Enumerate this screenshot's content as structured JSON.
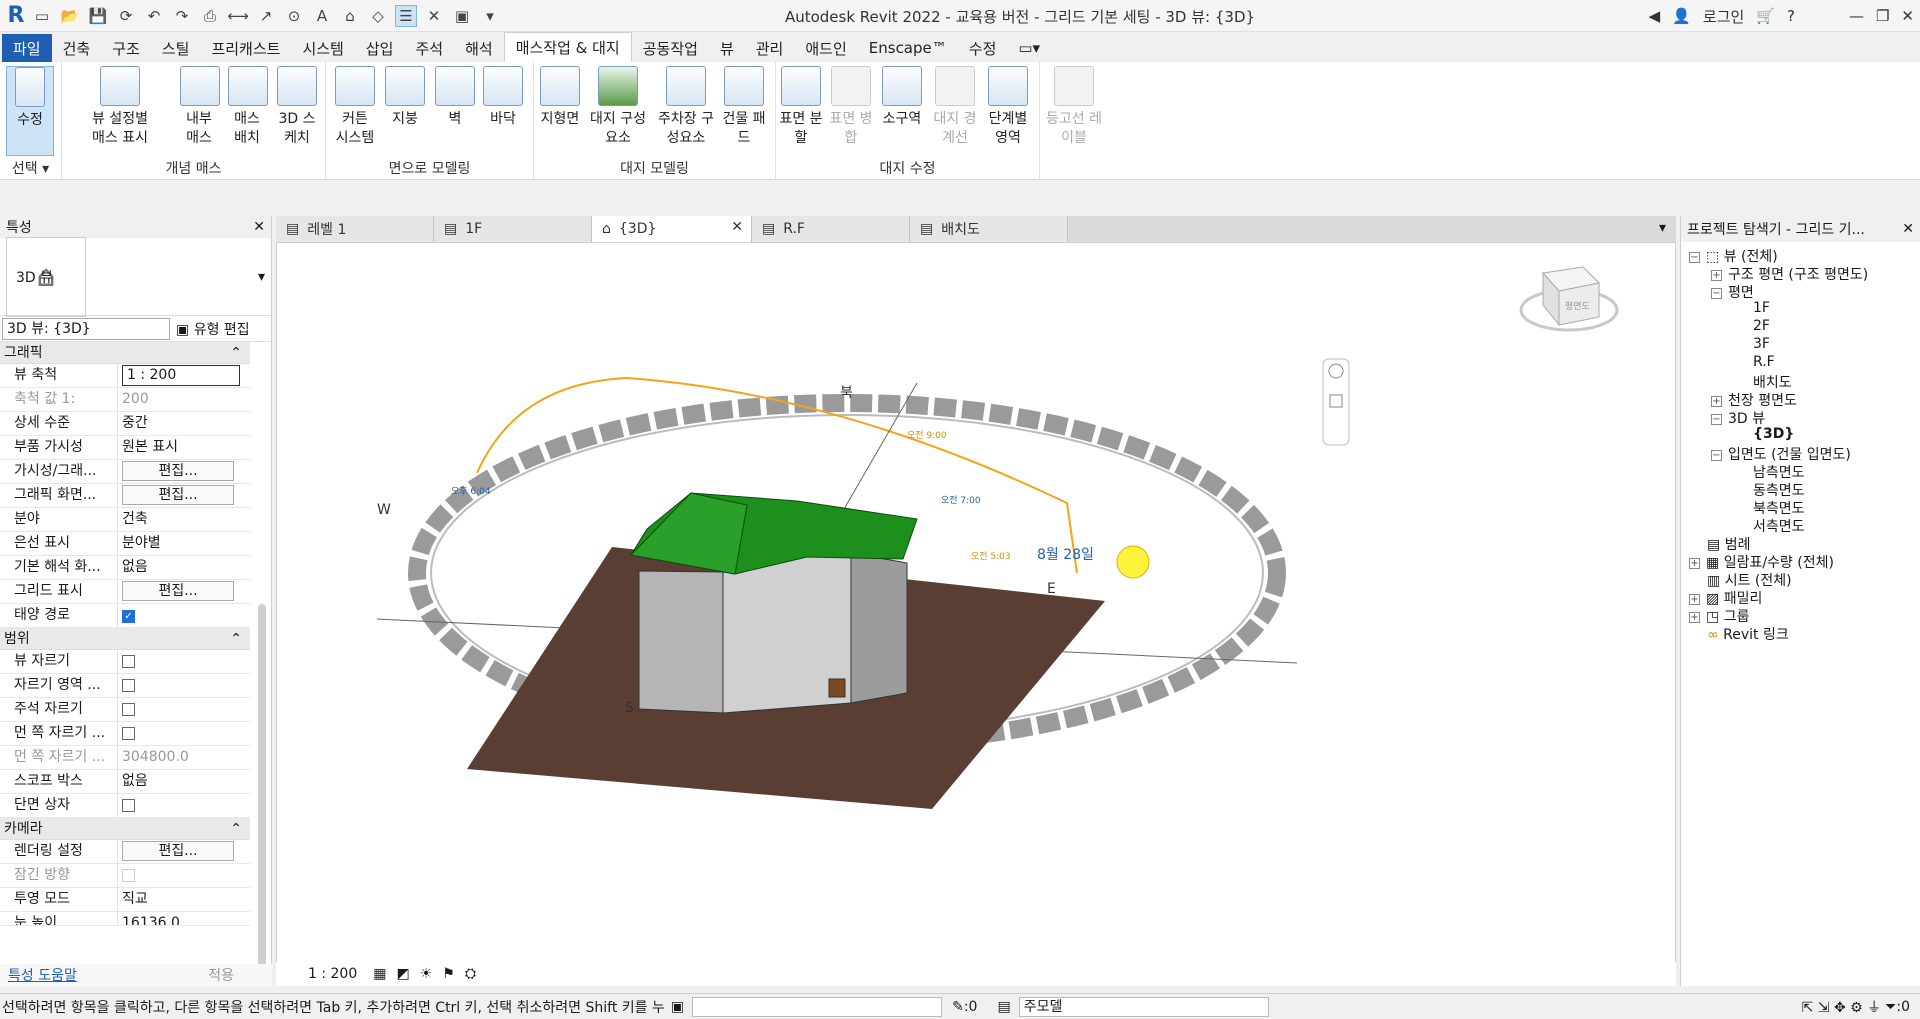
{
  "app": {
    "title": "Autodesk Revit 2022 - 교육용 버전 - 그리드 기본 세팅 - 3D 뷰: {3D}",
    "login": "로그인"
  },
  "tabs": [
    {
      "label": "파일"
    },
    {
      "label": "건축"
    },
    {
      "label": "구조"
    },
    {
      "label": "스틸"
    },
    {
      "label": "프리캐스트"
    },
    {
      "label": "시스템"
    },
    {
      "label": "삽입"
    },
    {
      "label": "주석"
    },
    {
      "label": "해석"
    },
    {
      "label": "매스작업 & 대지"
    },
    {
      "label": "공동작업"
    },
    {
      "label": "뷰"
    },
    {
      "label": "관리"
    },
    {
      "label": "애드인"
    },
    {
      "label": "Enscape™"
    },
    {
      "label": "수정"
    }
  ],
  "ribbon": {
    "panels": [
      "선택",
      "개념 매스",
      "면으로 모델링",
      "대지 모델링",
      "대지 수정"
    ],
    "buttons": {
      "modify": "수정",
      "show_mass": "뷰 설정별 매스 표시",
      "inplace_mass": "내부 매스",
      "place_mass": "매스 배치",
      "formit": "3D 스케치",
      "curtain": "커튼 시스템",
      "roof": "지붕",
      "wall": "벽",
      "floor": "바닥",
      "toposurface": "지형면",
      "site_component": "대지 구성요소",
      "parking": "주차장 구성요소",
      "pad": "건물 패드",
      "split_surface": "표면 분할",
      "merge_surface": "표면 병합",
      "subregion": "소구역",
      "property_line": "대지 경계선",
      "graded_region": "단계별 영역",
      "label_contours": "등고선 레이블"
    }
  },
  "properties": {
    "header": "특성",
    "type_name": "3D 뷰",
    "instance": "3D 뷰: {3D}",
    "edit_type": "유형 편집",
    "groups": {
      "graphics": "그래픽",
      "extents": "범위",
      "camera": "카메라"
    },
    "rows": {
      "scale": {
        "k": "뷰 축척",
        "v": "1 : 200"
      },
      "scale_value": {
        "k": "축척 값    1:",
        "v": "200"
      },
      "detail": {
        "k": "상세 수준",
        "v": "중간"
      },
      "parts": {
        "k": "부품 가시성",
        "v": "원본 표시"
      },
      "vg": {
        "k": "가시성/그래...",
        "v": "편집..."
      },
      "gdo": {
        "k": "그래픽 화면...",
        "v": "편집..."
      },
      "discipline": {
        "k": "분야",
        "v": "건축"
      },
      "hidden_line": {
        "k": "은선 표시",
        "v": "분야별"
      },
      "default_analysis": {
        "k": "기본 해석 화...",
        "v": "없음"
      },
      "grid_show": {
        "k": "그리드 표시",
        "v": "편집..."
      },
      "sun_path": {
        "k": "태양 경로",
        "v": ""
      },
      "crop_view": {
        "k": "뷰 자르기",
        "v": ""
      },
      "crop_visible": {
        "k": "자르기 영역 ...",
        "v": ""
      },
      "annotation_crop": {
        "k": "주석 자르기",
        "v": ""
      },
      "far_clip": {
        "k": "먼 쪽 자르기 ...",
        "v": ""
      },
      "far_offset": {
        "k": "먼 쪽 자르기 ...",
        "v": "304800.0"
      },
      "scope_box": {
        "k": "스코프 박스",
        "v": "없음"
      },
      "section_box": {
        "k": "단면 상자",
        "v": ""
      },
      "render": {
        "k": "렌더링 설정",
        "v": "편집..."
      },
      "locked": {
        "k": "잠긴 방향",
        "v": ""
      },
      "projection": {
        "k": "투영 모드",
        "v": "직교"
      },
      "eye": {
        "k": "눈 높이",
        "v": "16136.0"
      }
    },
    "help": "특성 도움말",
    "apply": "적용"
  },
  "view_tabs": [
    {
      "label": "레벨 1"
    },
    {
      "label": "1F"
    },
    {
      "label": "{3D}"
    },
    {
      "label": "R.F"
    },
    {
      "label": "배치도"
    }
  ],
  "view": {
    "scale": "1 : 200",
    "compass": {
      "n": "북",
      "s": "S",
      "e": "E",
      "w": "W"
    },
    "sun_labels": {
      "morning": "오전 9:00",
      "am7": "오전 7:00",
      "sunrise": "오전 5:03",
      "sunset": "오후 6:04",
      "date": "8월 28일"
    },
    "viewcube": "평면도"
  },
  "browser": {
    "header": "프로젝트 탐색기 - 그리드 기...",
    "items": [
      {
        "label": "뷰 (전체)"
      },
      {
        "label": "구조 평면 (구조 평면도)"
      },
      {
        "label": "평면"
      },
      {
        "label": "1F"
      },
      {
        "label": "2F"
      },
      {
        "label": "3F"
      },
      {
        "label": "R.F"
      },
      {
        "label": "배치도"
      },
      {
        "label": "천장 평면도"
      },
      {
        "label": "3D 뷰"
      },
      {
        "label": "{3D}"
      },
      {
        "label": "입면도 (건물 입면도)"
      },
      {
        "label": "남측면도"
      },
      {
        "label": "동측면도"
      },
      {
        "label": "북측면도"
      },
      {
        "label": "서측면도"
      },
      {
        "label": "범례"
      },
      {
        "label": "일람표/수량 (전체)"
      },
      {
        "label": "시트 (전체)"
      },
      {
        "label": "패밀리"
      },
      {
        "label": "그룹"
      },
      {
        "label": "Revit 링크"
      }
    ]
  },
  "status": {
    "message": "선택하려면 항목을 클릭하고, 다른 항목을 선택하려면 Tab 키, 추가하려면 Ctrl 키, 선택 취소하려면 Shift 키를 누",
    "count": ":0",
    "model": "주모델",
    "filter": ":0"
  }
}
